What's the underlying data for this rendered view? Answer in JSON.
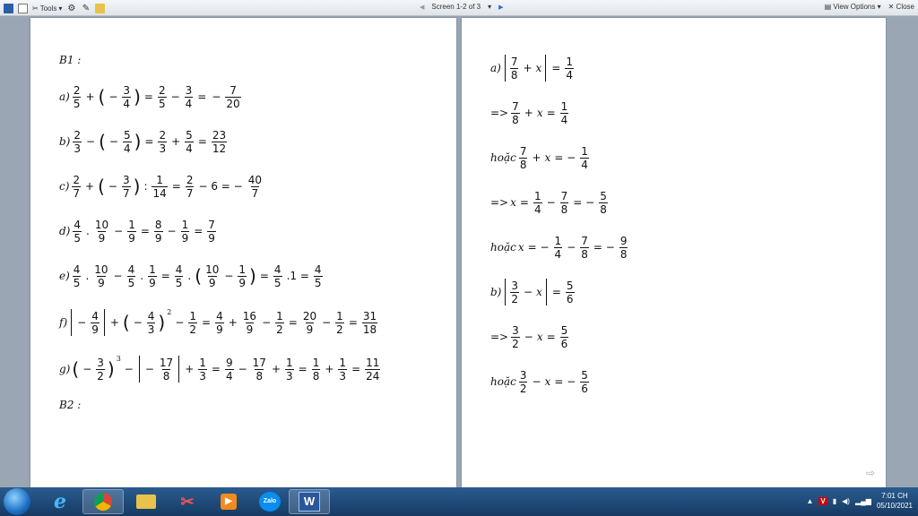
{
  "toolbar": {
    "tools_label": "Tools",
    "screen_label": "Screen 1-2 of 3",
    "view_options_label": "View Options",
    "close_label": "Close"
  },
  "left_page": {
    "b1": "B1 :",
    "a": "a)",
    "b": "b)",
    "c": "c)",
    "d": "d)",
    "e": "e)",
    "f": "f)",
    "g": "g)",
    "b2": "B2 :"
  },
  "right_page": {
    "a": "a)",
    "b": "b)",
    "implies": "=>",
    "or": "hoặc",
    "x": "x"
  },
  "taskbar": {
    "zalo": "Zalo",
    "word": "W",
    "time": "7:01 CH",
    "date": "05/10/2021"
  }
}
